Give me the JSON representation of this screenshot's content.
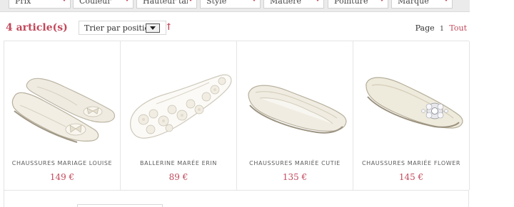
{
  "filters": [
    {
      "label": "Prix"
    },
    {
      "label": "Couleur"
    },
    {
      "label": "Hauteur talon"
    },
    {
      "label": "Style"
    },
    {
      "label": "Matière"
    },
    {
      "label": "Pointure"
    },
    {
      "label": "Marque"
    }
  ],
  "toolbar": {
    "count": "4 article(s)",
    "sort_label": "Trier par position",
    "sort_direction": "↑",
    "page_label": "Page",
    "page_number": "1",
    "show_all": "Tout"
  },
  "products": [
    {
      "name": "CHAUSSURES MARIAGE LOUISE",
      "price": "149 €",
      "image": "ivory-satin-ballet-flats-pair-with-bow"
    },
    {
      "name": "BALLERINE MARÉE ERIN",
      "price": "89 €",
      "image": "white-lace-floral-ballerina"
    },
    {
      "name": "CHAUSSURES MARIÉE CUTIE",
      "price": "135 €",
      "image": "ivory-satin-ballet-flat"
    },
    {
      "name": "CHAUSSURES MARIÉE FLOWER",
      "price": "145 €",
      "image": "ivory-peep-toe-flat-with-jewel-brooch"
    }
  ],
  "colors": {
    "accent": "#c2485a",
    "filter_bar": "#ebebeb",
    "border": "#e4e4e4",
    "satin": "#efebe1"
  }
}
